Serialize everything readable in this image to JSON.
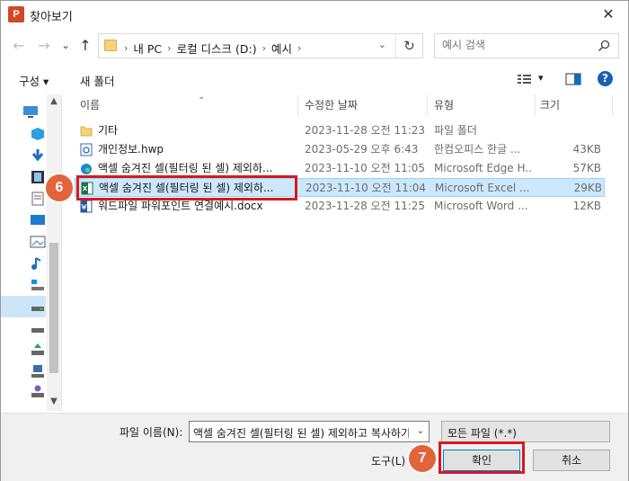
{
  "window": {
    "title": "찾아보기",
    "app_icon_letter": "P",
    "close_glyph": "✕"
  },
  "navigation": {
    "back_glyph": "←",
    "forward_glyph": "→",
    "recent_glyph": "⌄",
    "up_glyph": "↑",
    "breadcrumbs": [
      "내 PC",
      "로컬 디스크 (D:)",
      "예시"
    ],
    "refresh_glyph": "↻",
    "search_placeholder": "예시 검색"
  },
  "toolbar": {
    "organize_label": "구성 ▾",
    "new_folder_label": "새 폴더",
    "view_dd_glyph": "▾",
    "help_glyph": "?"
  },
  "columns": {
    "name": "이름",
    "date": "수정한 날짜",
    "type": "유형",
    "size": "크기"
  },
  "files": [
    {
      "icon": "folder-icon",
      "name": "기타",
      "date": "2023-11-28 오전 11:23",
      "type": "파일 폴더",
      "size": ""
    },
    {
      "icon": "hwp-file-icon",
      "name": "개인정보.hwp",
      "date": "2023-05-29 오후 6:43",
      "type": "한컴오피스 한글 ...",
      "size": "43KB"
    },
    {
      "icon": "edge-file-icon",
      "name": "액셀 숨겨진 셀(필터링 된 셀) 제외하...",
      "date": "2023-11-10 오전 11:05",
      "type": "Microsoft Edge H...",
      "size": "57KB"
    },
    {
      "icon": "excel-file-icon",
      "name": "액셀 숨겨진 셀(필터링 된 셀) 제외하...",
      "date": "2023-11-10 오전 11:04",
      "type": "Microsoft Excel ...",
      "size": "29KB"
    },
    {
      "icon": "word-file-icon",
      "name": "워드파일 파워포인트 연결예시.docx",
      "date": "2023-11-28 오전 11:25",
      "type": "Microsoft Word ...",
      "size": "12KB"
    }
  ],
  "selected_index": 3,
  "bottom": {
    "filename_label": "파일 이름(N):",
    "filename_value": "액셀 숨겨진 셀(필터링 된 셀) 제외하고 복사하기",
    "filetype_value": "모든 파일 (*.*)",
    "tools_label": "도구(L)",
    "ok_label": "확인",
    "cancel_label": "취소"
  },
  "steps": {
    "step_select_file": "6",
    "step_confirm": "7"
  },
  "colors": {
    "highlight": "#d7191c",
    "badge": "#e3643a",
    "selection": "#cce8ff"
  }
}
